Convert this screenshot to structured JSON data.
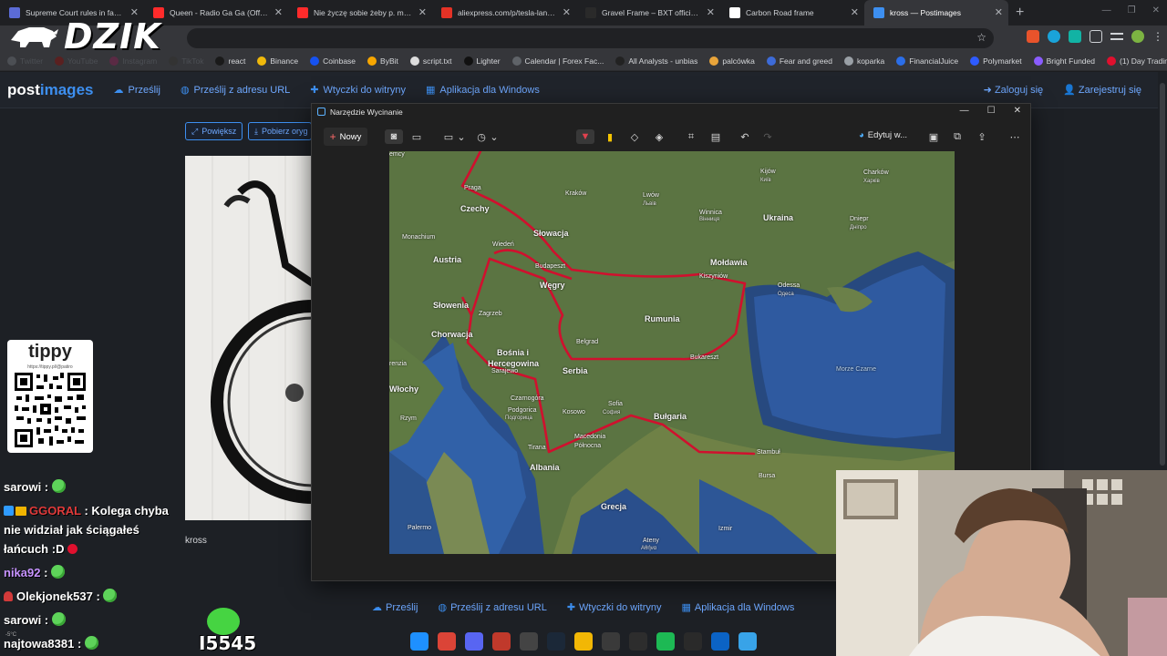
{
  "browser": {
    "tabs": [
      {
        "label": "Supreme Court rules in favor of...",
        "fav": "#5b6bd6",
        "active": false
      },
      {
        "label": "Queen - Radio Ga Ga (Offic...",
        "fav": "#ff2b2b",
        "active": false
      },
      {
        "label": "Nie życzę sobie żeby p. mnie n...",
        "fav": "#ff2b2b",
        "active": false
      },
      {
        "label": "aliexpress.com/p/tesla-landing...",
        "fav": "#e43226",
        "active": false
      },
      {
        "label": "Gravel Frame – BXT official sto...",
        "fav": "#2a2a2a",
        "active": false
      },
      {
        "label": "Carbon Road frame",
        "fav": "#ffffff",
        "active": false
      },
      {
        "label": "kross — Postimages",
        "fav": "#3d8ff0",
        "active": true
      }
    ],
    "bookmarks": [
      {
        "label": "Twitter",
        "color": "#4c4f54",
        "dim": true
      },
      {
        "label": "YouTube",
        "color": "#5a2020",
        "dim": true
      },
      {
        "label": "Instagram",
        "color": "#5a2a44",
        "dim": true
      },
      {
        "label": "TikTok",
        "color": "#333",
        "dim": true
      },
      {
        "label": "react",
        "color": "#1a1a1a",
        "dim": false
      },
      {
        "label": "Binance",
        "color": "#f0b90b",
        "dim": false
      },
      {
        "label": "Coinbase",
        "color": "#1652f0",
        "dim": false
      },
      {
        "label": "ByBit",
        "color": "#f7a600",
        "dim": false
      },
      {
        "label": "script.txt",
        "color": "#dddddd",
        "dim": false
      },
      {
        "label": "Lighter",
        "color": "#111111",
        "dim": false
      },
      {
        "label": "Calendar | Forex Fac...",
        "color": "#5f6368",
        "dim": false
      },
      {
        "label": "All Analysts - unbias",
        "color": "#222222",
        "dim": false
      },
      {
        "label": "palcówka",
        "color": "#e8a43a",
        "dim": false
      },
      {
        "label": "Fear and greed",
        "color": "#3d6bd8",
        "dim": false
      },
      {
        "label": "koparka",
        "color": "#9aa0a6",
        "dim": false
      },
      {
        "label": "FinancialJuice",
        "color": "#2b6ee8",
        "dim": false
      },
      {
        "label": "Polymarket",
        "color": "#2e5bff",
        "dim": false
      },
      {
        "label": "Bright Funded",
        "color": "#8a5cff",
        "dim": false
      },
      {
        "label": "(1) Day Trading Boo...",
        "color": "#e0102e",
        "dim": false
      }
    ]
  },
  "overlay_logo": "DZIK",
  "site": {
    "brand_a": "post",
    "brand_b": "images",
    "nav": [
      {
        "label": "Prześlij",
        "icon": "upload-cloud-icon"
      },
      {
        "label": "Prześlij z adresu URL",
        "icon": "globe-icon"
      },
      {
        "label": "Wtyczki do witryny",
        "icon": "plugin-icon"
      },
      {
        "label": "Aplikacja dla Windows",
        "icon": "windows-icon"
      }
    ],
    "login": "Zaloguj się",
    "register": "Zarejestruj się",
    "zoom_button": "Powiększ",
    "download_button": "Pobierz oryg",
    "caption": "kross"
  },
  "snipping": {
    "title": "Narzędzie Wycinanie",
    "new_button": "Nowy",
    "edit_button": "Edytuj w..."
  },
  "map": {
    "countries": [
      {
        "name": "Czechy"
      },
      {
        "name": "Słowacja"
      },
      {
        "name": "Austria"
      },
      {
        "name": "Węgry"
      },
      {
        "name": "Słowenia"
      },
      {
        "name": "Chorwacja"
      },
      {
        "name": "Bośnia i"
      },
      {
        "name": "Hercegowina"
      },
      {
        "name": "Serbia"
      },
      {
        "name": "Rumunia"
      },
      {
        "name": "Mołdawia"
      },
      {
        "name": "Ukraina"
      },
      {
        "name": "Bułgaria"
      },
      {
        "name": "Albania"
      },
      {
        "name": "Grecja"
      },
      {
        "name": "Włochy"
      }
    ],
    "cities": [
      "emcy",
      "Praga",
      "Kraków",
      "Lwów",
      "Львів",
      "Winnica",
      "Вінниця",
      "Kijów",
      "Київ",
      "Charków",
      "Харків",
      "Dniepr",
      "Дніпро",
      "Monachium",
      "Wiedeń",
      "Budapeszt",
      "Kiszyniów",
      "Odessa",
      "Одеса",
      "Zagrzeb",
      "Sarajewo",
      "Belgrad",
      "Bukareszt",
      "Czarnogóra",
      "Podgorica",
      "Подгорица",
      "Kosowo",
      "Sofia",
      "София",
      "Macedonia",
      "Północna",
      "Tirana",
      "Stambuł",
      "Bursa",
      "Rzym",
      "Palermo",
      "Ateny",
      "Αθήνα",
      "Izmir",
      "renzia"
    ],
    "sea": "Morze Czarne"
  },
  "tippy": {
    "name": "tippy",
    "url": "https://tippy.pl/@patiro"
  },
  "chat": [
    {
      "user": "sarowi",
      "color": "#ffffff",
      "text": "",
      "emoji": true
    },
    {
      "user": "GGORAL",
      "color": "#e03a3a",
      "text": "Kolega chyba nie widział jak ściągałeś łańcuch :D",
      "emoji": false
    },
    {
      "user": "nika92",
      "color": "#c793ff",
      "text": "",
      "emoji": true
    },
    {
      "user": "Olekjonek537",
      "color": "#ffffff",
      "text": "",
      "emoji": true
    },
    {
      "user": "sarowi",
      "color": "#ffffff",
      "text": "",
      "emoji": true
    },
    {
      "user": "najtowa8381",
      "color": "#ffffff",
      "text": "",
      "emoji": true
    }
  ],
  "sub_counter": "I5545",
  "weather": "-5°C",
  "taskbar": [
    {
      "name": "windows-start",
      "color": "#1e90ff"
    },
    {
      "name": "chrome",
      "color": "#db4437"
    },
    {
      "name": "discord",
      "color": "#5865f2"
    },
    {
      "name": "app-red",
      "color": "#c0392b"
    },
    {
      "name": "obs",
      "color": "#444"
    },
    {
      "name": "steam",
      "color": "#1b2838"
    },
    {
      "name": "explorer",
      "color": "#f2b705"
    },
    {
      "name": "app-c",
      "color": "#3a3a3a"
    },
    {
      "name": "tools",
      "color": "#2d2d2d"
    },
    {
      "name": "spotify",
      "color": "#1db954"
    },
    {
      "name": "app-video",
      "color": "#2a2a2a"
    },
    {
      "name": "app-snip",
      "color": "#0b63c5"
    },
    {
      "name": "notepad",
      "color": "#38a3e8"
    }
  ]
}
